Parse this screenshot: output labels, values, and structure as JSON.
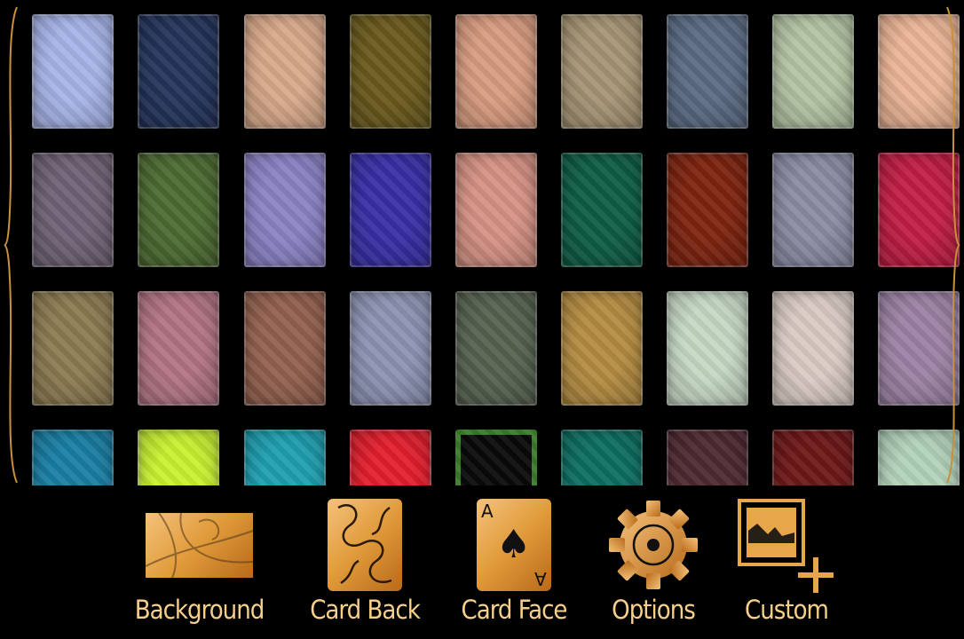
{
  "card_backs": [
    [
      "#a7b4e8",
      "#24345a",
      "#d8a98a",
      "#6b5a1e",
      "#d89c80",
      "#a69474",
      "#5b6b83",
      "#b4c4a4",
      "#ebb596"
    ],
    [
      "#6f6275",
      "#4d6b32",
      "#8b82c4",
      "#3a2fa6",
      "#d69284",
      "#0f5e46",
      "#7e2410",
      "#8a8ca4",
      "#c01e44"
    ],
    [
      "#8c7b52",
      "#b27484",
      "#93614f",
      "#8d93b3",
      "#566250",
      "#b48c42",
      "#c6d8c4",
      "#dacbc4",
      "#9c82a4"
    ],
    [
      "#1a7fa4",
      "#c9f132",
      "#1f9fb0",
      "#e21f2e",
      "#0a0a0a",
      "#0e6f62",
      "#4f2a32",
      "#6e1818",
      "#b2d2bb"
    ]
  ],
  "toolbar": {
    "background_label": "Background",
    "card_back_label": "Card Back",
    "card_face_label": "Card Face",
    "options_label": "Options",
    "custom_label": "Custom",
    "card_face_rank": "A"
  },
  "colors": {
    "accent": "#f6d08a",
    "bracket": "#c8903a"
  }
}
